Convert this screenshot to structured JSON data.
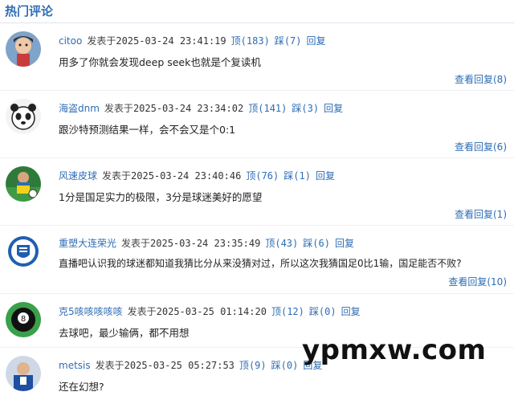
{
  "section": {
    "title": "热门评论"
  },
  "labels": {
    "posted_at": "发表于",
    "up": "顶",
    "down": "踩",
    "reply": "回复",
    "view_replies": "查看回复"
  },
  "comments": [
    {
      "user": "citoo",
      "time": "2025-03-24 23:41:19",
      "up": "183",
      "down": "7",
      "text": "用多了你就会发现deep seek也就是个复读机",
      "view_count": "8",
      "avatar_icon": "girl-avatar-icon"
    },
    {
      "user": "海盗dnm",
      "time": "2025-03-24 23:34:02",
      "up": "141",
      "down": "3",
      "text": "跟沙特预测结果一样，会不会又是个0:1",
      "view_count": "6",
      "avatar_icon": "panda-avatar-icon"
    },
    {
      "user": "风速皮球",
      "time": "2025-03-24 23:40:46",
      "up": "76",
      "down": "1",
      "text": "1分是国足实力的极限，3分是球迷美好的愿望",
      "view_count": "1",
      "avatar_icon": "soccer-player-avatar-icon"
    },
    {
      "user": "重塑大连荣光",
      "time": "2025-03-24 23:35:49",
      "up": "43",
      "down": "6",
      "text": "直播吧认识我的球迷都知道我猜比分从来没猜对过，所以这次我猜国足0比1输，国足能否不败?",
      "view_count": "10",
      "avatar_icon": "club-badge-avatar-icon"
    },
    {
      "user": "克5咳咳咳咳咳",
      "time": "2025-03-25 01:14:20",
      "up": "12",
      "down": "0",
      "text": "去球吧，最少输俩，都不用想",
      "view_count": "",
      "avatar_icon": "billiard-ball-avatar-icon"
    },
    {
      "user": "metsis",
      "time": "2025-03-25 05:27:53",
      "up": "9",
      "down": "0",
      "text": "还在幻想?",
      "view_count": "",
      "avatar_icon": "blue-player-avatar-icon"
    }
  ],
  "watermark": "ypmxw.com",
  "colors": {
    "link": "#2e6db4",
    "text": "#222222",
    "divider": "#dde5ef"
  }
}
